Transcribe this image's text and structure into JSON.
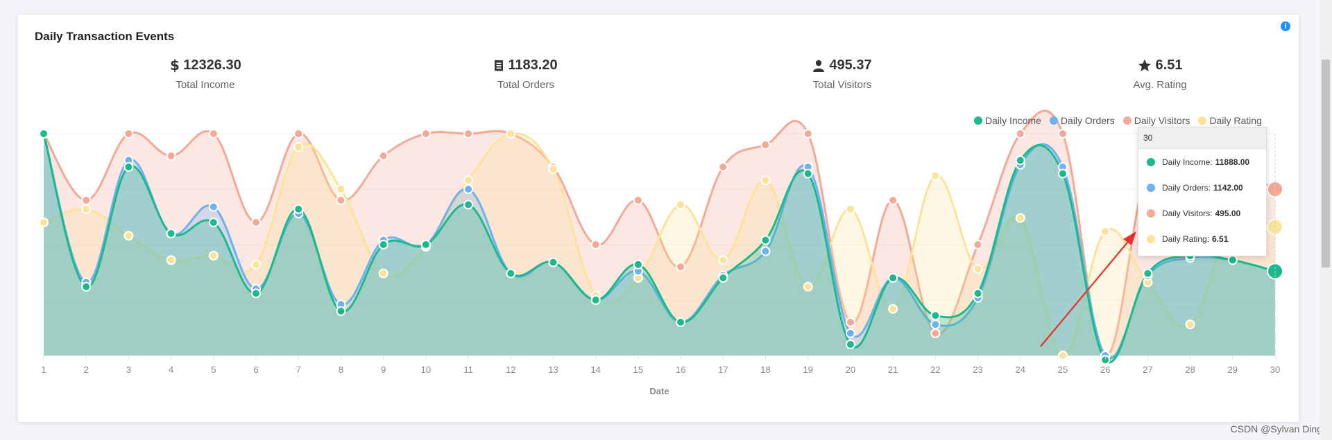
{
  "title": "Daily Transaction Events",
  "stats": [
    {
      "icon": "dollar-icon",
      "value": "12326.30",
      "label": "Total Income"
    },
    {
      "icon": "receipt-icon",
      "value": "1183.20",
      "label": "Total Orders"
    },
    {
      "icon": "user-icon",
      "value": "495.37",
      "label": "Total Visitors"
    },
    {
      "icon": "star-icon",
      "value": "6.51",
      "label": "Avg. Rating"
    }
  ],
  "info_icon": "i",
  "tooltip": {
    "header": "30",
    "rows": [
      {
        "label": "Daily Income:",
        "value": "11888.00",
        "color": "#1cb98d"
      },
      {
        "label": "Daily Orders:",
        "value": "1142.00",
        "color": "#6eb1ef"
      },
      {
        "label": "Daily Visitors:",
        "value": "495.00",
        "color": "#f4a896"
      },
      {
        "label": "Daily Rating:",
        "value": "6.51",
        "color": "#fde39a"
      }
    ]
  },
  "watermark": "CSDN @Sylvan Ding",
  "chart_data": {
    "type": "area",
    "x": [
      1,
      2,
      3,
      4,
      5,
      6,
      7,
      8,
      9,
      10,
      11,
      12,
      13,
      14,
      15,
      16,
      17,
      18,
      19,
      20,
      21,
      22,
      23,
      24,
      25,
      26,
      27,
      28,
      29,
      30
    ],
    "xlabel": "Date",
    "ylabel": "",
    "ylim": [
      0,
      100
    ],
    "grid": true,
    "legend_position": "top-right",
    "series": [
      {
        "name": "Daily Income",
        "color": "#1cb98d",
        "values": [
          100,
          31,
          85,
          55,
          60,
          28,
          66,
          20,
          50,
          50,
          68,
          37,
          42,
          25,
          41,
          15,
          35,
          52,
          82,
          5,
          35,
          18,
          28,
          88,
          82,
          -2,
          37,
          45,
          43,
          38
        ]
      },
      {
        "name": "Daily Orders",
        "color": "#6eb1ef",
        "values": [
          100,
          33,
          88,
          55,
          67,
          30,
          64,
          23,
          52,
          50,
          75,
          37,
          42,
          25,
          38,
          15,
          36,
          47,
          85,
          10,
          35,
          14,
          26,
          86,
          85,
          0,
          36,
          44,
          43,
          38
        ]
      },
      {
        "name": "Daily Visitors",
        "color": "#f4a896",
        "values": [
          100,
          70,
          100,
          90,
          100,
          60,
          100,
          70,
          90,
          100,
          100,
          100,
          85,
          50,
          70,
          40,
          85,
          95,
          100,
          15,
          70,
          10,
          50,
          100,
          100,
          0,
          85,
          90,
          85,
          75
        ]
      },
      {
        "name": "Daily Rating",
        "color": "#fde39a",
        "values": [
          60,
          66,
          54,
          43,
          45,
          41,
          94,
          75,
          37,
          49,
          79,
          100,
          84,
          27,
          35,
          68,
          43,
          79,
          31,
          66,
          21,
          81,
          39,
          62,
          0,
          56,
          33,
          14,
          61,
          58
        ]
      }
    ]
  }
}
